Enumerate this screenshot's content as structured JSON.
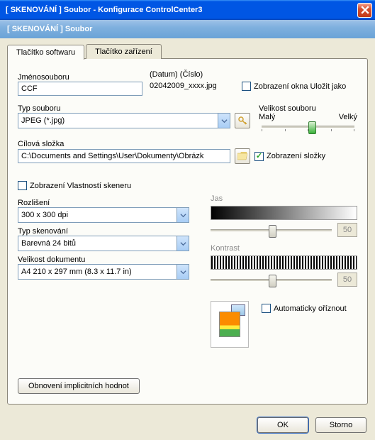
{
  "window": {
    "title": "[  SKENOVÁNÍ  ]    Soubor  -  Konfigurace ControlCenter3"
  },
  "subheader": "[  SKENOVÁNÍ  ]    Soubor",
  "tabs": {
    "software": "Tlačítko softwaru",
    "device": "Tlačítko zařízení"
  },
  "labels": {
    "filename": "Jménosouboru",
    "filetype": "Typ souboru",
    "destfolder": "Cílová složka",
    "date_number": "(Datum)   (Číslo)",
    "example": "02042009_xxxx.jpg",
    "show_saveas": "Zobrazení okna Uložit jako",
    "filesize": "Velikost souboru",
    "small": "Malý",
    "large": "Velký",
    "show_folder": "Zobrazení složky",
    "show_scanner_props": "Zobrazení Vlastností skeneru",
    "resolution": "Rozlišení",
    "scantype": "Typ skenování",
    "docsize": "Velikost dokumentu",
    "jas": "Jas",
    "kontrast": "Kontrast",
    "autocrop": "Automaticky oříznout",
    "restore": "Obnovení implicitních hodnot"
  },
  "values": {
    "filename": "CCF",
    "filetype": "JPEG (*.jpg)",
    "destfolder": "C:\\Documents and Settings\\User\\Dokumenty\\Obrázk",
    "resolution": "300 x 300 dpi",
    "scantype": "Barevná 24 bitů",
    "docsize": "A4 210 x 297 mm (8.3 x 11.7 in)",
    "jas_readout": "50",
    "kontrast_readout": "50"
  },
  "buttons": {
    "ok": "OK",
    "cancel": "Storno"
  }
}
